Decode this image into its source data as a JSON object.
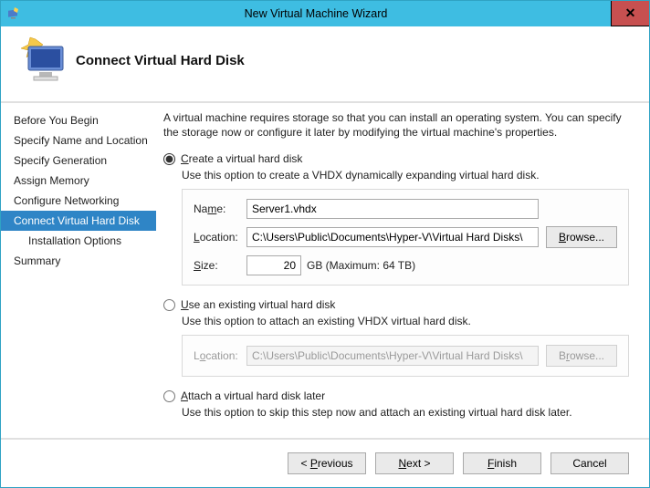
{
  "window": {
    "title": "New Virtual Machine Wizard"
  },
  "header": {
    "title": "Connect Virtual Hard Disk"
  },
  "sidebar": {
    "steps": [
      {
        "label": "Before You Begin",
        "selected": false
      },
      {
        "label": "Specify Name and Location",
        "selected": false
      },
      {
        "label": "Specify Generation",
        "selected": false
      },
      {
        "label": "Assign Memory",
        "selected": false
      },
      {
        "label": "Configure Networking",
        "selected": false
      },
      {
        "label": "Connect Virtual Hard Disk",
        "selected": true
      },
      {
        "label": "Installation Options",
        "selected": false,
        "sub": true
      },
      {
        "label": "Summary",
        "selected": false
      }
    ]
  },
  "content": {
    "intro": "A virtual machine requires storage so that you can install an operating system. You can specify the storage now or configure it later by modifying the virtual machine's properties.",
    "opt_create": {
      "label": "Create a virtual hard disk",
      "desc": "Use this option to create a VHDX dynamically expanding virtual hard disk.",
      "name_label": "Name:",
      "name_value": "Server1.vhdx",
      "location_label": "Location:",
      "location_value": "C:\\Users\\Public\\Documents\\Hyper-V\\Virtual Hard Disks\\",
      "browse_label": "Browse...",
      "size_label": "Size:",
      "size_value": "20",
      "size_suffix": "GB (Maximum: 64 TB)"
    },
    "opt_existing": {
      "label": "Use an existing virtual hard disk",
      "desc": "Use this option to attach an existing VHDX virtual hard disk.",
      "location_label": "Location:",
      "location_value": "C:\\Users\\Public\\Documents\\Hyper-V\\Virtual Hard Disks\\",
      "browse_label": "Browse..."
    },
    "opt_later": {
      "label": "Attach a virtual hard disk later",
      "desc": "Use this option to skip this step now and attach an existing virtual hard disk later."
    }
  },
  "footer": {
    "previous": "< Previous",
    "next": "Next >",
    "finish": "Finish",
    "cancel": "Cancel"
  }
}
